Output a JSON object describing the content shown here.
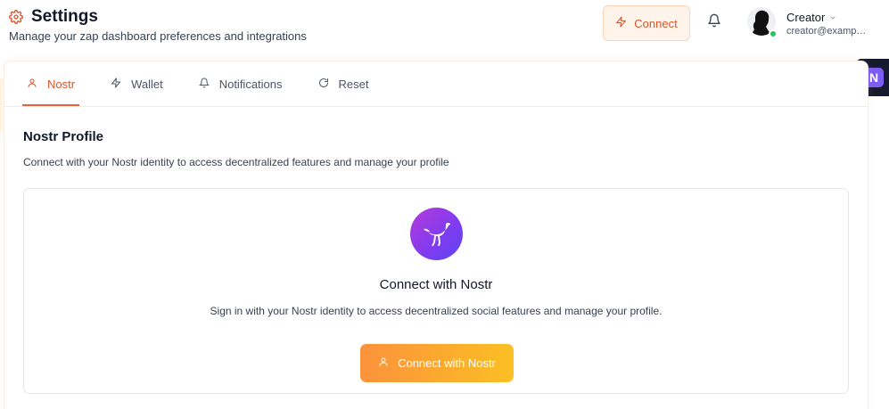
{
  "header": {
    "title": "Settings",
    "subtitle": "Manage your zap dashboard preferences and integrations",
    "connect_label": "Connect",
    "user": {
      "name": "Creator",
      "email": "creator@exampl..."
    }
  },
  "side_badge": {
    "label": "N"
  },
  "tabs": [
    {
      "label": "Nostr",
      "icon": "user-icon",
      "active": true
    },
    {
      "label": "Wallet",
      "icon": "lightning-icon",
      "active": false
    },
    {
      "label": "Notifications",
      "icon": "bell-icon",
      "active": false
    },
    {
      "label": "Reset",
      "icon": "refresh-icon",
      "active": false
    }
  ],
  "section": {
    "title": "Nostr Profile",
    "description": "Connect with your Nostr identity to access decentralized features and manage your profile"
  },
  "connect_panel": {
    "title": "Connect with Nostr",
    "description": "Sign in with your Nostr identity to access decentralized social features and manage your profile.",
    "button_label": "Connect with Nostr"
  },
  "colors": {
    "accent": "#e2653a",
    "button_gradient_start": "#fb923c",
    "button_gradient_end": "#fbbf24",
    "nostr_purple": "#7e3cf0",
    "online": "#22c55e"
  }
}
